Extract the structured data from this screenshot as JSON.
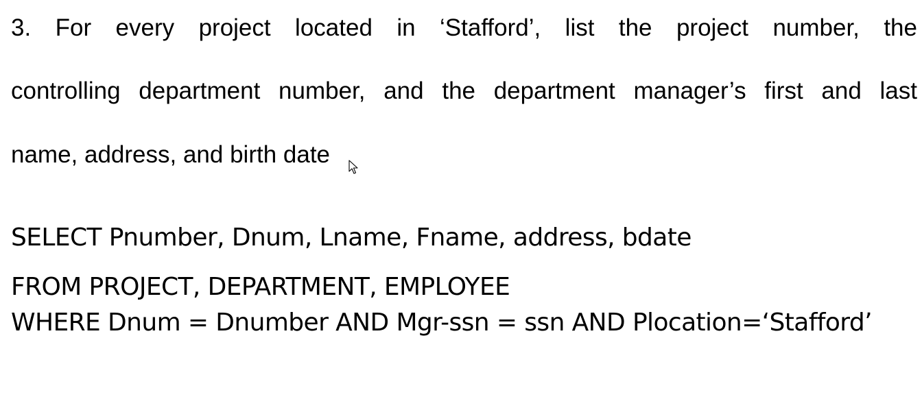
{
  "question": {
    "line1": "3. For every project located in ‘Stafford’, list the project number, the",
    "line2": "controlling department number, and the department manager’s first and last",
    "line3": "name, address, and birth date"
  },
  "sql": {
    "select": "SELECT Pnumber, Dnum, Lname, Fname, address, bdate",
    "from": "FROM PROJECT, DEPARTMENT, EMPLOYEE",
    "where": "WHERE Dnum = Dnumber AND Mgr-ssn = ssn AND Plocation=‘Stafford’"
  },
  "icons": {
    "cursor": "mouse-pointer-icon"
  }
}
